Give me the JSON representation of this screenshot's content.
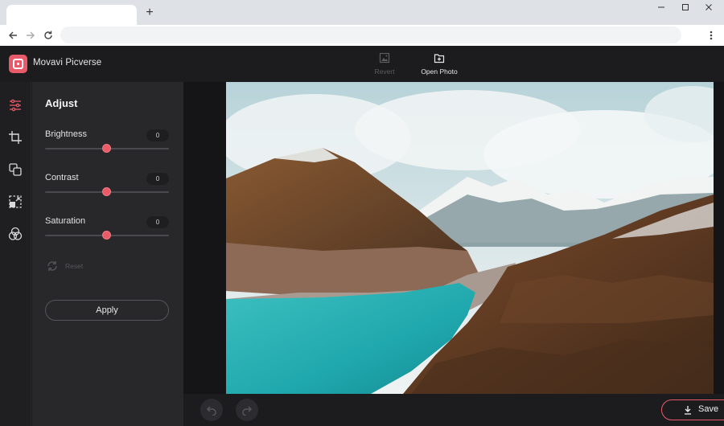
{
  "browser": {
    "new_tab_label": "+",
    "address_value": ""
  },
  "app": {
    "title": "Movavi Picverse",
    "header_actions": [
      {
        "label": "Revert",
        "icon": "image-icon",
        "enabled": false
      },
      {
        "label": "Open Photo",
        "icon": "folder-plus-icon",
        "enabled": true
      }
    ]
  },
  "rail": {
    "items": [
      {
        "name": "adjust",
        "icon": "sliders-icon",
        "active": true
      },
      {
        "name": "crop",
        "icon": "crop-icon",
        "active": false
      },
      {
        "name": "layers",
        "icon": "overlap-squares-icon",
        "active": false
      },
      {
        "name": "resize",
        "icon": "resize-icon",
        "active": false
      },
      {
        "name": "color",
        "icon": "rgb-circles-icon",
        "active": false
      }
    ]
  },
  "panel": {
    "title": "Adjust",
    "sliders": [
      {
        "label": "Brightness",
        "value": "0"
      },
      {
        "label": "Contrast",
        "value": "0"
      },
      {
        "label": "Saturation",
        "value": "0"
      }
    ],
    "reset_label": "Reset",
    "apply_label": "Apply"
  },
  "bottom": {
    "save_label": "Save"
  },
  "colors": {
    "accent": "#e85a6a",
    "background": "#1c1c1e",
    "panel": "#28282b"
  }
}
